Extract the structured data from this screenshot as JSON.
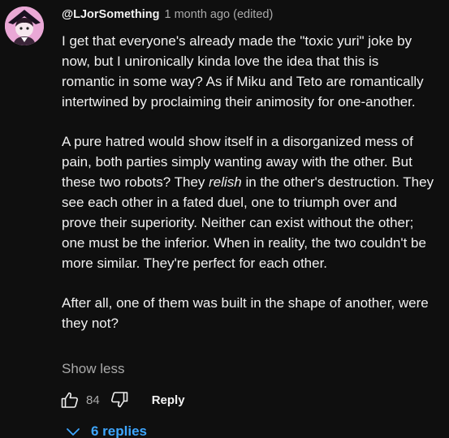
{
  "comment": {
    "author": "@LJorSomething",
    "meta": "1 month ago (edited)",
    "paragraphs": [
      {
        "before": "I get that everyone's already made the \"toxic yuri\" joke by now, but I unironically kinda love the idea that this is romantic in some way? As if Miku and Teto are romantically intertwined by proclaiming their animosity for one-another.",
        "emphasis": "",
        "after": ""
      },
      {
        "before": "A pure hatred would show itself in a disorganized mess of pain, both parties simply wanting away with the other. But these two robots? They ",
        "emphasis": "relish",
        "after": " in the other's destruction. They see each other in a fated duel, one to triumph over and prove their superiority. Neither can exist without the other; one must be the inferior. When in reality, the two couldn't be more similar. They're perfect for each other."
      },
      {
        "before": "After all, one of them was built in the shape of another, were they not?",
        "emphasis": "",
        "after": ""
      }
    ],
    "show_less_label": "Show less",
    "like_count": "84",
    "reply_label": "Reply",
    "replies_label": "6 replies"
  },
  "icons": {
    "like": "thumbs-up-icon",
    "dislike": "thumbs-down-icon",
    "replies": "chevron-down-icon"
  },
  "colors": {
    "background": "#0f0f0f",
    "text": "#f1f1f1",
    "secondary_text": "#aaaaaa",
    "link": "#3ea6ff"
  }
}
